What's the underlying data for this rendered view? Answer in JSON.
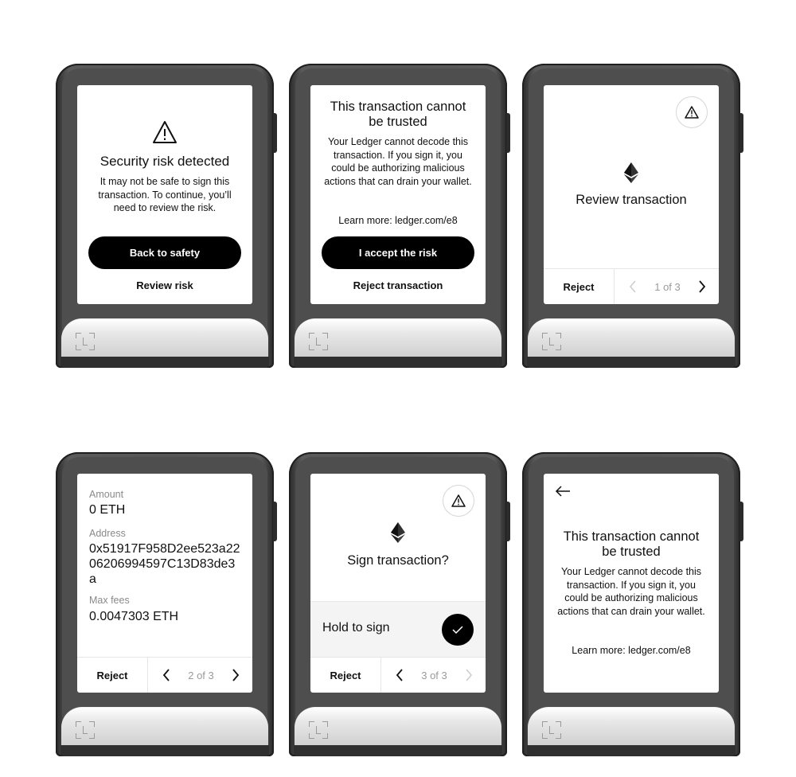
{
  "screens": {
    "security_risk": {
      "title": "Security risk detected",
      "body": "It may not be safe to sign this transaction. To continue, you’ll need to review the risk.",
      "primary_button": "Back to safety",
      "secondary_link": "Review risk",
      "icon": "warning-triangle-icon"
    },
    "untrusted_accept": {
      "title": "This transaction cannot be trusted",
      "body": "Your Ledger cannot decode this transaction. If you sign it, you could be authorizing malicious actions that can drain your wallet.",
      "learn_more": "Learn more: ledger.com/e8",
      "primary_button": "I accept the risk",
      "secondary_link": "Reject transaction"
    },
    "review_transaction": {
      "title": "Review transaction",
      "reject": "Reject",
      "page": "1 of 3",
      "icon": "ethereum-icon"
    },
    "details": {
      "amount_label": "Amount",
      "amount_value": "0 ETH",
      "address_label": "Address",
      "address_value": "0x51917F958D2ee523a2206206994597C13D83de3a",
      "fees_label": "Max fees",
      "fees_value": "0.0047303 ETH",
      "reject": "Reject",
      "page": "2 of 3"
    },
    "sign_transaction": {
      "title": "Sign transaction?",
      "hold_label": "Hold to sign",
      "reject": "Reject",
      "page": "3 of 3"
    },
    "untrusted_info": {
      "title": "This transaction cannot be trusted",
      "body": "Your Ledger cannot decode this transaction. If you sign it, you could be authorizing malicious actions that can drain your wallet.",
      "learn_more": "Learn more: ledger.com/e8"
    }
  },
  "colors": {
    "device_body": "#565656",
    "screen": "#ffffff",
    "button": "#000000",
    "base": "#e8e8e8"
  }
}
